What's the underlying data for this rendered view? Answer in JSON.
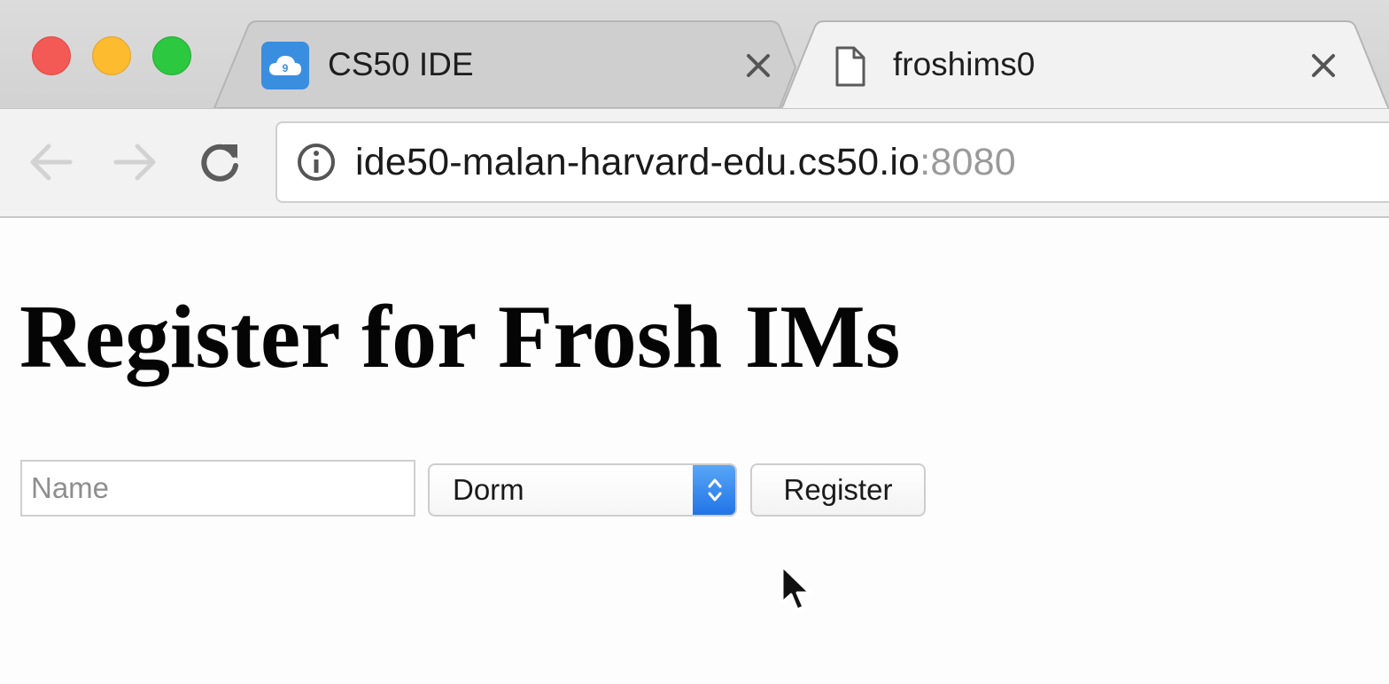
{
  "browser": {
    "tabs": [
      {
        "title": "CS50 IDE",
        "favicon": "cloud9-icon",
        "active": false
      },
      {
        "title": "froshims0",
        "favicon": "page-icon",
        "active": true
      }
    ],
    "address_bar": {
      "host": "ide50-malan-harvard-edu.cs50.io",
      "port": ":8080"
    }
  },
  "page": {
    "title": "Register for Frosh IMs",
    "form": {
      "name_placeholder": "Name",
      "name_value": "",
      "dorm_selected": "Dorm",
      "submit_label": "Register"
    }
  },
  "colors": {
    "traffic_close": "#f35a55",
    "traffic_minimize": "#fdbb2f",
    "traffic_maximize": "#2cc840",
    "select_accent": "#2f85ec"
  }
}
